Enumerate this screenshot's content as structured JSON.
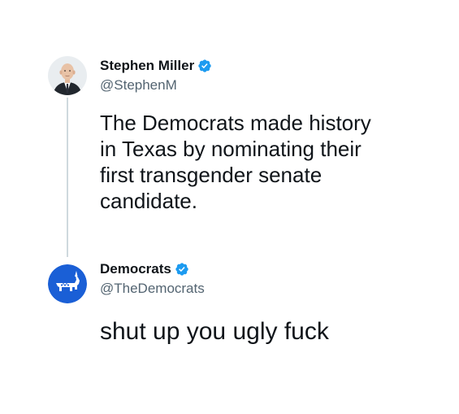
{
  "tweet_1": {
    "display_name": "Stephen Miller",
    "handle": "@StephenM",
    "text": "The Democrats made history\nin Texas by nominating their\nfirst transgender senate\ncandidate."
  },
  "tweet_2": {
    "display_name": "Democrats",
    "handle": "@TheDemocrats",
    "text": "shut up you ugly fuck"
  },
  "colors": {
    "text_primary": "#0f1419",
    "text_secondary": "#536471",
    "verified": "#1d9bf0",
    "thread_line": "#cfd9de",
    "democrats_blue": "#1a5fd6"
  },
  "icons": {
    "avatar_1": "profile-photo",
    "avatar_2": "democrats-donkey-logo",
    "verified": "verified-badge-icon"
  }
}
